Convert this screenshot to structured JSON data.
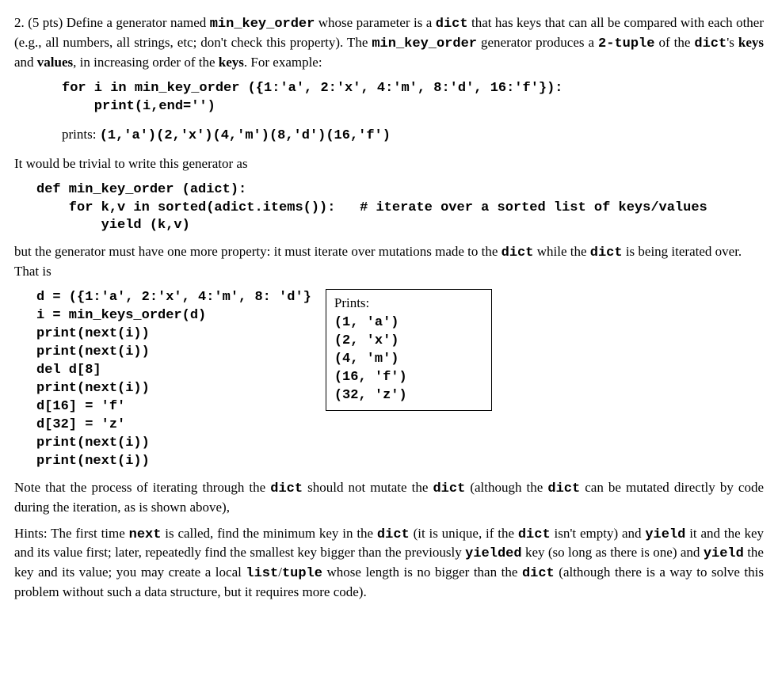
{
  "problem": {
    "number": "2.",
    "points": "(5  pts)",
    "intro_1a": "Define a generator named ",
    "fn_name": "min_key_order",
    "intro_1b": " whose parameter is a ",
    "dict_word": "dict",
    "intro_1c": " that has keys that can all be compared with each other (e.g., all numbers, all strings, etc; don't check this property). The ",
    "intro_1d": " generator produces a ",
    "two_tuple": "2-tuple",
    "intro_1e": " of the ",
    "intro_1f": "'s ",
    "keys_b": "keys",
    "and_w": " and ",
    "values_b": "values",
    "intro_1g": ", in increasing order of the ",
    "intro_1h": ".  For example:"
  },
  "code1_line1": "for i in min_key_order ({1:'a', 2:'x', 4:'m', 8:'d', 16:'f'}):",
  "code1_line2": "    print(i,end='')",
  "prints_label": "prints: ",
  "prints_value": "(1,'a')(2,'x')(4,'m')(8,'d')(16,'f')",
  "trivial_text": "It would be trivial to write this generator as",
  "code2_line1": "def min_key_order (adict):",
  "code2_line2": "    for k,v in sorted(adict.items()):   # iterate over a sorted list of keys/values",
  "code2_line3": "        yield (k,v)",
  "but_text_a": "but the generator must have one more property: it must iterate over mutations made to the ",
  "but_text_b": " while the ",
  "but_text_c": " is being iterated over. That is",
  "code3_lines": "d = ({1:'a', 2:'x', 4:'m', 8: 'd'}\ni = min_keys_order(d)\nprint(next(i))\nprint(next(i))\ndel d[8]\nprint(next(i))\nd[16] = 'f'\nd[32] = 'z'\nprint(next(i))\nprint(next(i))",
  "prints_box": {
    "header": "Prints:",
    "out": "(1, 'a')\n(2, 'x')\n(4, 'm')\n(16, 'f')\n(32, 'z')"
  },
  "note_a": "Note that the process of iterating through the ",
  "note_b": " should not mutate the ",
  "note_c": " (although the ",
  "note_d": " can be mutated directly by code during the iteration, as is shown above),",
  "hints_a": "Hints: The first time ",
  "next_w": "next",
  "hints_b": " is called, find the minimum key in the ",
  "hints_c": " (it is unique, if the ",
  "hints_d": " isn't empty) and ",
  "yield_w": "yield",
  "hints_e": " it and the key and its value first; later, repeatedly find the smallest key bigger than the previously ",
  "yielded_w": "yielded",
  "hints_f": " key (so long as there is one) and ",
  "hints_g": " the key and its value; you may create a local ",
  "list_w": "list",
  "tuple_w": "tuple",
  "hints_h": " whose length is no bigger than the ",
  "hints_i": " (although there is a way to solve this problem without such a data structure, but it requires more code)."
}
